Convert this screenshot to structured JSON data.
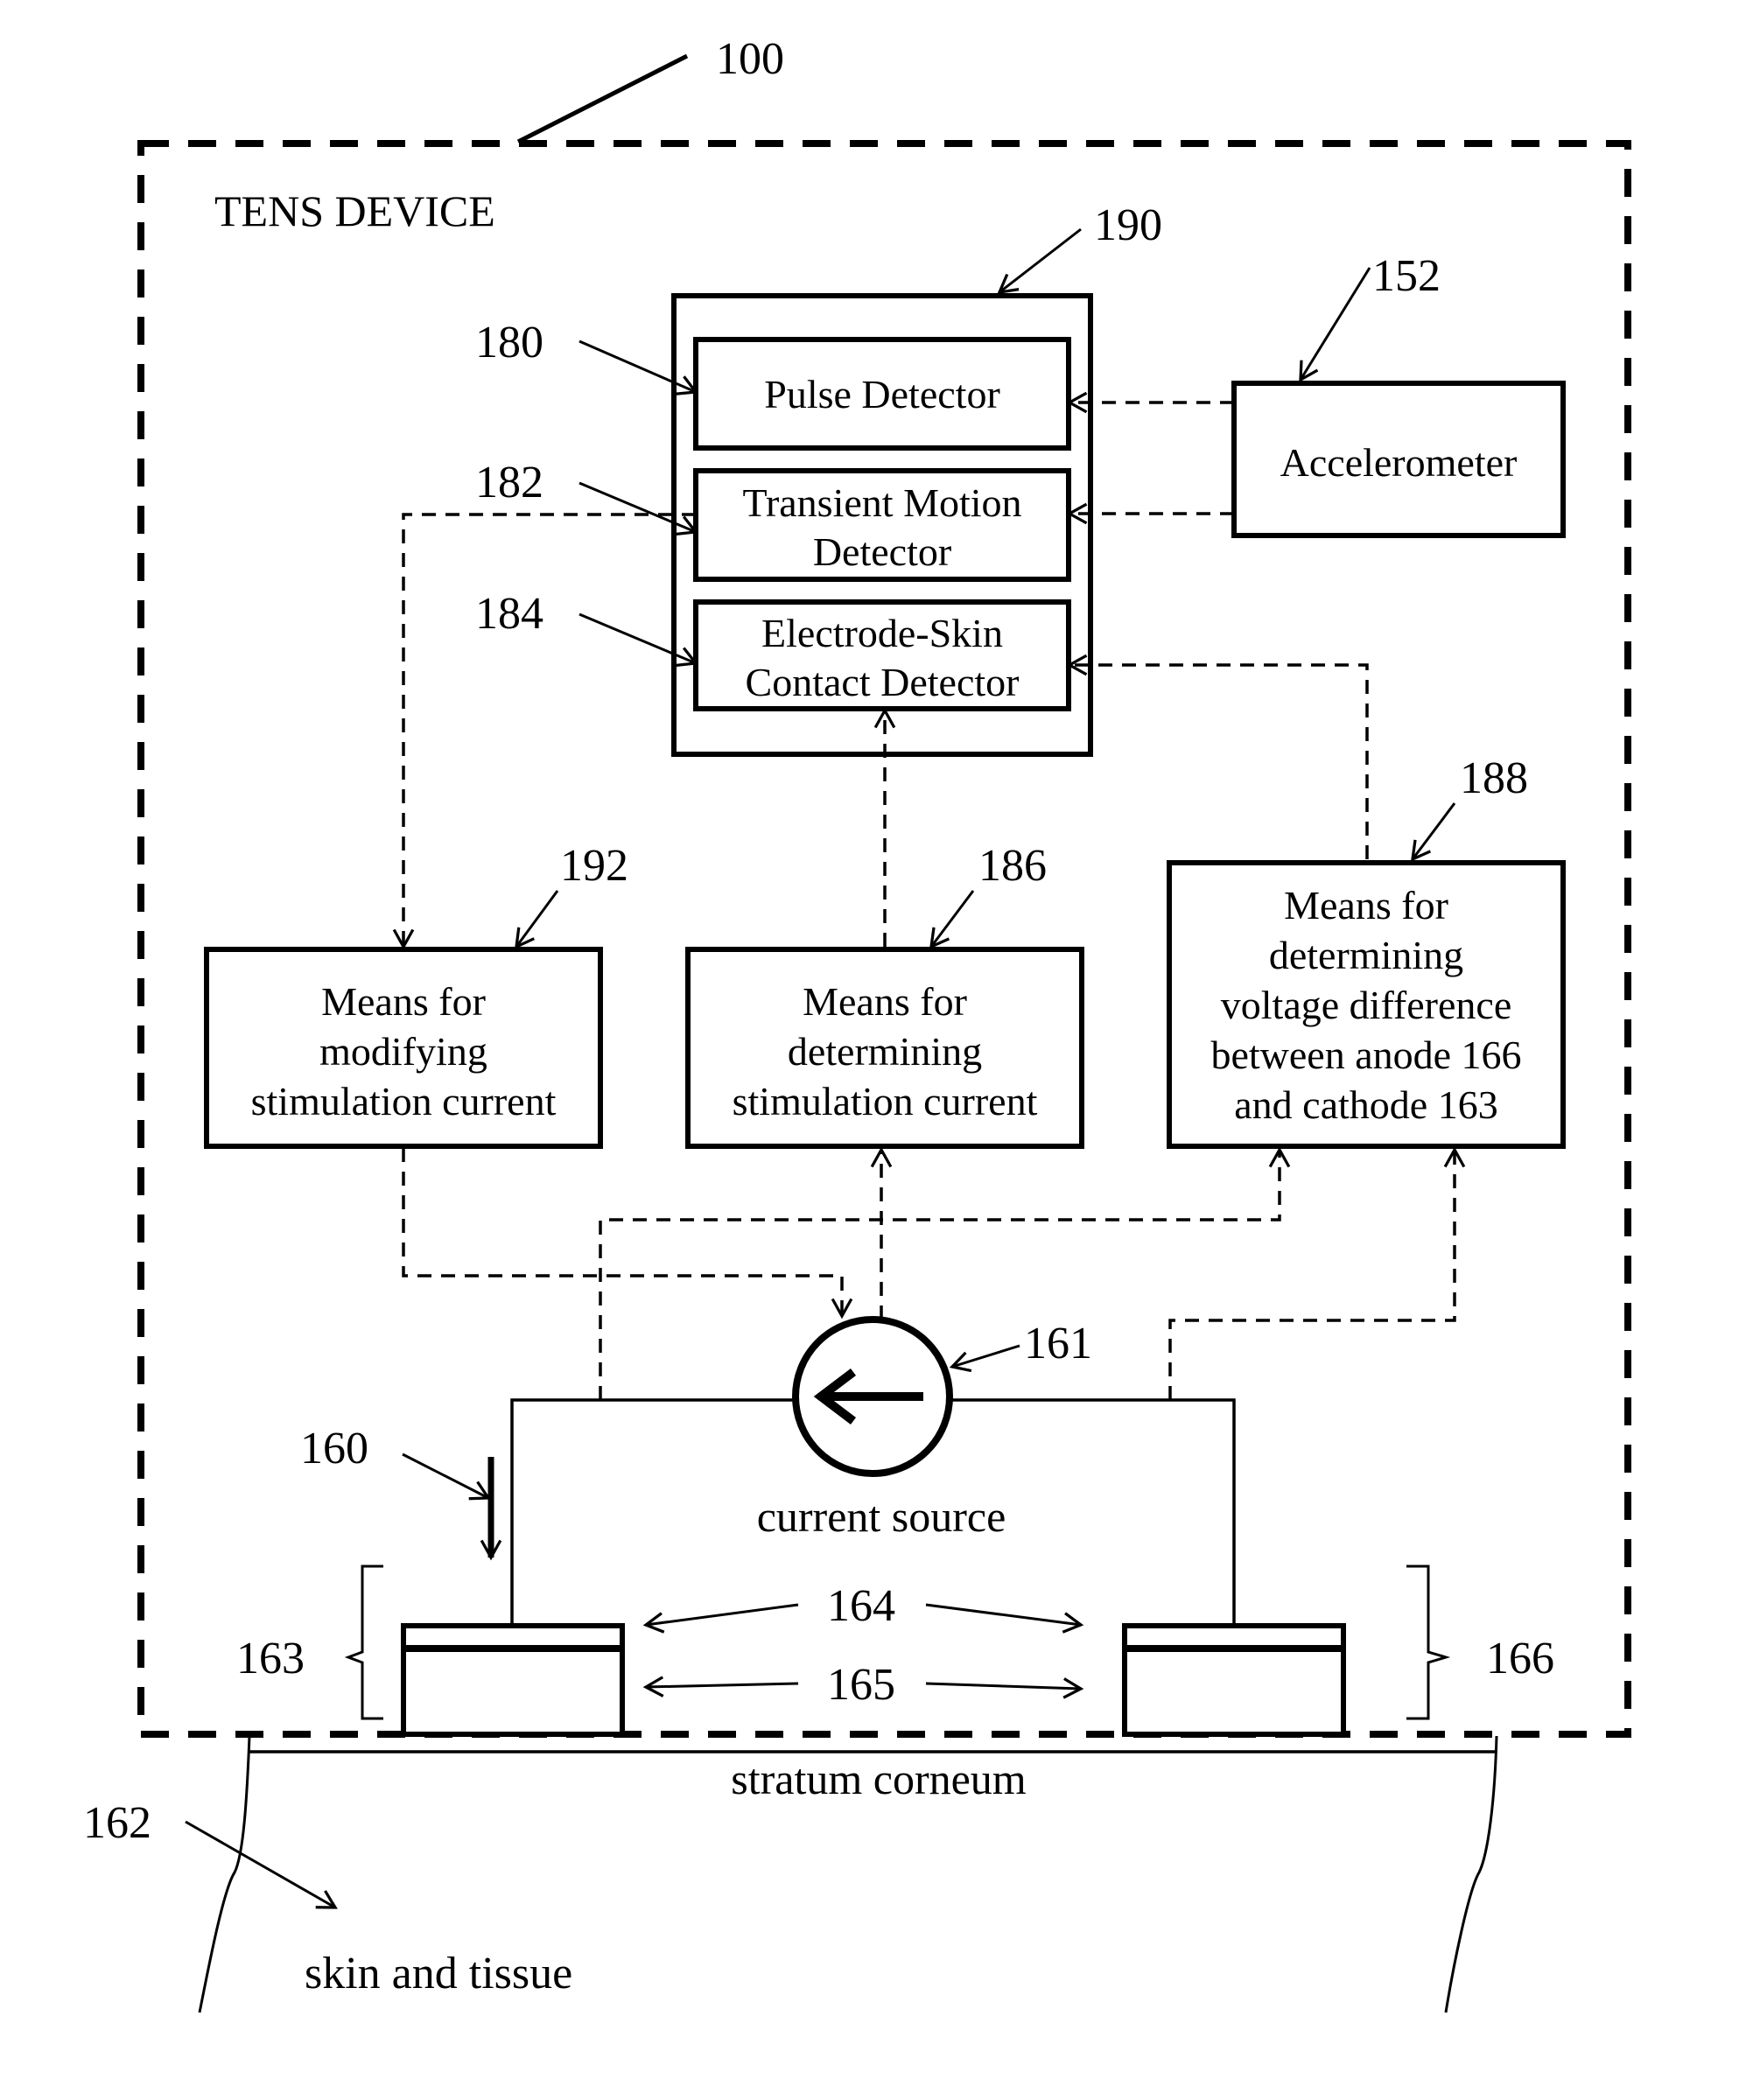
{
  "figure": {
    "ref_number": "100",
    "device_label": "TENS DEVICE"
  },
  "detector_group": {
    "ref": "190",
    "items": [
      {
        "ref": "180",
        "lines": [
          "Pulse Detector"
        ]
      },
      {
        "ref": "182",
        "lines": [
          "Transient Motion",
          "Detector"
        ]
      },
      {
        "ref": "184",
        "lines": [
          "Electrode-Skin",
          "Contact Detector"
        ]
      }
    ]
  },
  "accelerometer": {
    "ref": "152",
    "label": "Accelerometer"
  },
  "means_boxes": [
    {
      "ref": "192",
      "lines": [
        "Means for",
        "modifying",
        "stimulation current"
      ]
    },
    {
      "ref": "186",
      "lines": [
        "Means for",
        "determining",
        "stimulation current"
      ]
    },
    {
      "ref": "188",
      "lines": [
        "Means for",
        "determining",
        "voltage difference",
        "between anode 166",
        "and cathode 163"
      ]
    }
  ],
  "circuit": {
    "current_source_ref": "161",
    "current_source_label": "current source",
    "circuit_ref": "160",
    "cathode_ref": "163",
    "anode_ref": "166",
    "layer_ref_top": "164",
    "layer_ref_bottom": "165"
  },
  "skin": {
    "stratum_label": "stratum corneum",
    "tissue_ref": "162",
    "tissue_label": "skin and tissue"
  }
}
